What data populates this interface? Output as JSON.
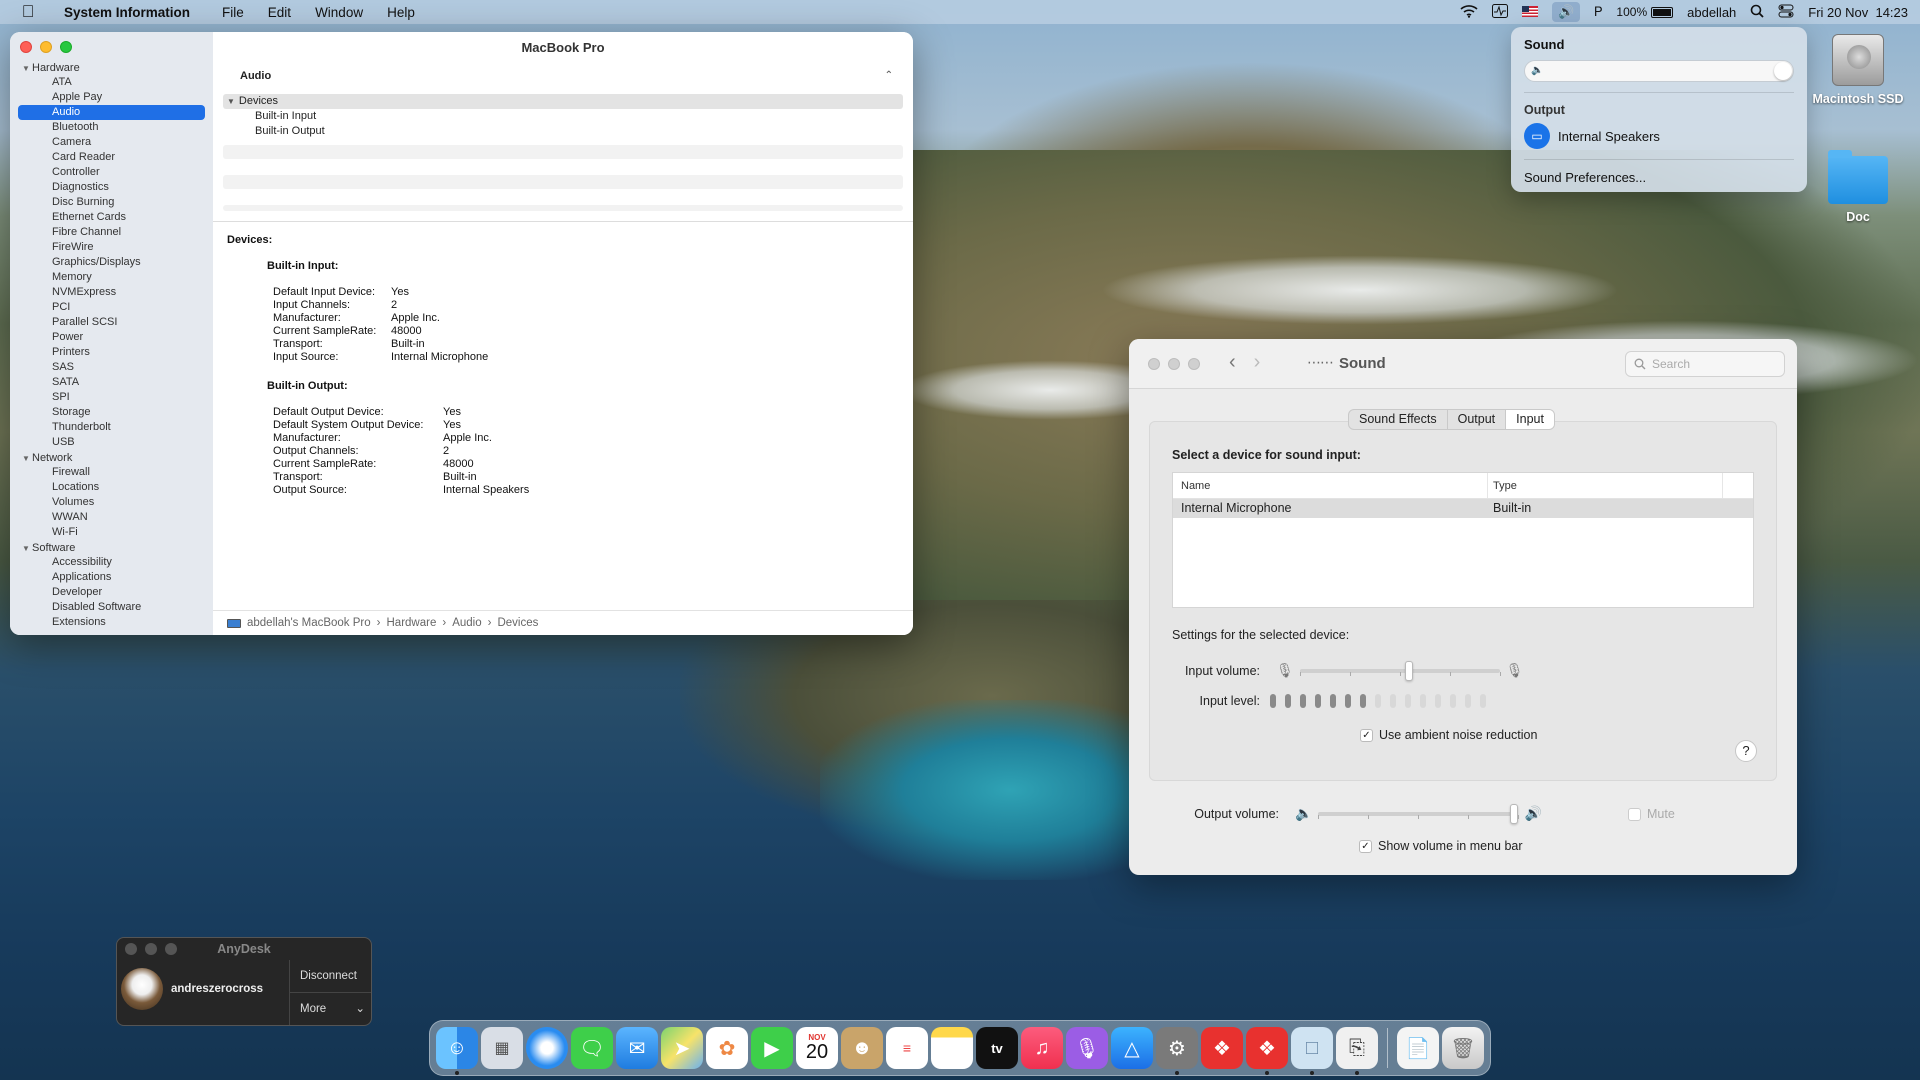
{
  "menubar": {
    "app_name": "System Information",
    "menus": [
      "File",
      "Edit",
      "Window",
      "Help"
    ],
    "battery": "100%",
    "user": "abdellah",
    "datetime": "Fri 20 Nov  14:23"
  },
  "sound_menu": {
    "title": "Sound",
    "volume_fraction": 1.0,
    "output_label": "Output",
    "output_device": "Internal Speakers",
    "preferences_link": "Sound Preferences..."
  },
  "desktop": {
    "icons": [
      "Macintosh SSD",
      "Doc"
    ]
  },
  "system_info": {
    "title": "MacBook Pro",
    "sidebar": [
      {
        "category": "Hardware",
        "items": [
          "ATA",
          "Apple Pay",
          "Audio",
          "Bluetooth",
          "Camera",
          "Card Reader",
          "Controller",
          "Diagnostics",
          "Disc Burning",
          "Ethernet Cards",
          "Fibre Channel",
          "FireWire",
          "Graphics/Displays",
          "Memory",
          "NVMExpress",
          "PCI",
          "Parallel SCSI",
          "Power",
          "Printers",
          "SAS",
          "SATA",
          "SPI",
          "Storage",
          "Thunderbolt",
          "USB"
        ]
      },
      {
        "category": "Network",
        "items": [
          "Firewall",
          "Locations",
          "Volumes",
          "WWAN",
          "Wi-Fi"
        ]
      },
      {
        "category": "Software",
        "items": [
          "Accessibility",
          "Applications",
          "Developer",
          "Disabled Software",
          "Extensions"
        ]
      }
    ],
    "selected_item": "Audio",
    "section_header": "Audio",
    "tree": {
      "head": "Devices",
      "children": [
        "Built-in Input",
        "Built-in Output"
      ]
    },
    "detail": {
      "heading": "Devices:",
      "input": {
        "title": "Built-in Input:",
        "rows": [
          [
            "Default Input Device:",
            "Yes"
          ],
          [
            "Input Channels:",
            "2"
          ],
          [
            "Manufacturer:",
            "Apple Inc."
          ],
          [
            "Current SampleRate:",
            "48000"
          ],
          [
            "Transport:",
            "Built-in"
          ],
          [
            "Input Source:",
            "Internal Microphone"
          ]
        ]
      },
      "output": {
        "title": "Built-in Output:",
        "rows": [
          [
            "Default Output Device:",
            "Yes"
          ],
          [
            "Default System Output Device:",
            "Yes"
          ],
          [
            "Manufacturer:",
            "Apple Inc."
          ],
          [
            "Output Channels:",
            "2"
          ],
          [
            "Current SampleRate:",
            "48000"
          ],
          [
            "Transport:",
            "Built-in"
          ],
          [
            "Output Source:",
            "Internal Speakers"
          ]
        ]
      }
    },
    "path": [
      "abdellah's MacBook Pro",
      "Hardware",
      "Audio",
      "Devices"
    ]
  },
  "sound_prefs": {
    "title": "Sound",
    "search_placeholder": "Search",
    "tabs": [
      "Sound Effects",
      "Output",
      "Input"
    ],
    "active_tab": "Input",
    "select_heading": "Select a device for sound input:",
    "table_headers": [
      "Name",
      "Type"
    ],
    "table_rows": [
      [
        "Internal Microphone",
        "Built-in"
      ]
    ],
    "settings_heading": "Settings for the selected device:",
    "input_volume_label": "Input volume:",
    "input_volume_fraction": 0.55,
    "input_level_label": "Input level:",
    "input_level_on": 7,
    "input_level_total": 15,
    "noise_reduction_label": "Use ambient noise reduction",
    "noise_reduction_checked": true,
    "output_volume_label": "Output volume:",
    "output_volume_fraction": 1.0,
    "mute_label": "Mute",
    "mute_checked": false,
    "show_volume_label": "Show volume in menu bar",
    "show_volume_checked": true,
    "help": "?"
  },
  "anydesk": {
    "title": "AnyDesk",
    "user": "andreszerocross",
    "disconnect": "Disconnect",
    "more": "More"
  },
  "dock": {
    "calendar_month": "NOV",
    "calendar_day": "20",
    "apps": [
      "finder",
      "launchpad",
      "safari",
      "messages",
      "mail",
      "maps",
      "photos",
      "facetime",
      "calendar",
      "contacts",
      "reminders",
      "notes",
      "tv",
      "music",
      "podcasts",
      "app-store",
      "system-preferences",
      "anydesk",
      "anydesk-session",
      "preview",
      "screenshot",
      "documents",
      "trash"
    ],
    "tv_label": "tv"
  }
}
